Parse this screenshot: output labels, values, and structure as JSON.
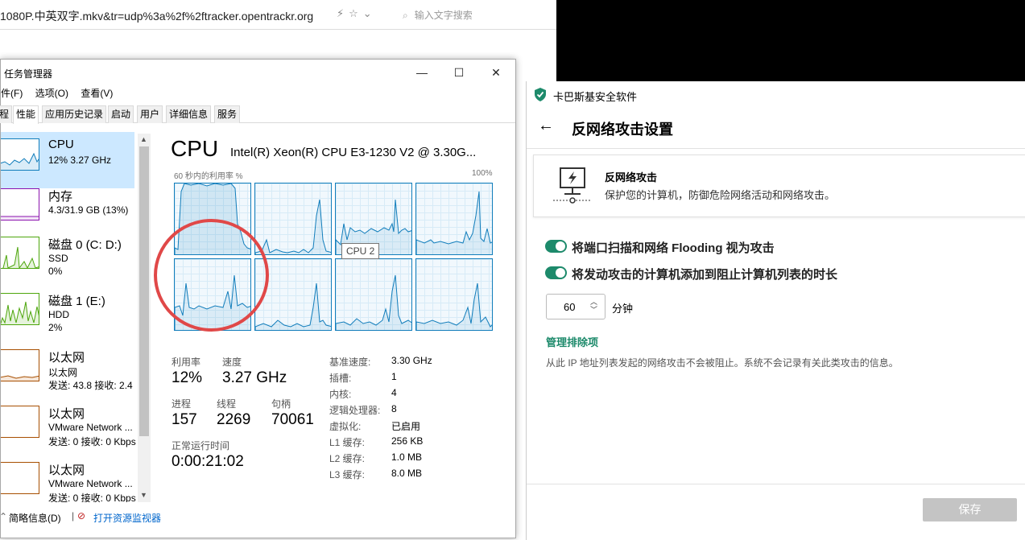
{
  "browser": {
    "url": "1080P.中英双字.mkv&tr=udp%3a%2f%2ftracker.opentrackr.org",
    "search_placeholder": "输入文字搜索"
  },
  "taskmgr": {
    "title": "任务管理器",
    "menus": [
      "件(F)",
      "选项(O)",
      "查看(V)"
    ],
    "tabs": [
      "程",
      "性能",
      "应用历史记录",
      "启动",
      "用户",
      "详细信息",
      "服务"
    ],
    "active_tab": "性能",
    "sidebar": [
      {
        "name": "CPU",
        "sub1": "12%  3.27 GHz",
        "sub2": "",
        "color": "#117dbb"
      },
      {
        "name": "内存",
        "sub1": "4.3/31.9 GB (13%)",
        "sub2": "",
        "color": "#8b12ae"
      },
      {
        "name": "磁盘 0 (C: D:)",
        "sub1": "SSD",
        "sub2": "0%",
        "color": "#4da60c"
      },
      {
        "name": "磁盘 1 (E:)",
        "sub1": "HDD",
        "sub2": "2%",
        "color": "#4da60c"
      },
      {
        "name": "以太网",
        "sub1": "以太网",
        "sub2": "发送: 43.8 接收: 2.4",
        "color": "#a74f01"
      },
      {
        "name": "以太网",
        "sub1": "VMware Network ...",
        "sub2": "发送: 0 接收: 0 Kbps",
        "color": "#a74f01"
      },
      {
        "name": "以太网",
        "sub1": "VMware Network ...",
        "sub2": "发送: 0 接收: 0 Kbps",
        "color": "#a74f01"
      }
    ],
    "cpu_header": "CPU",
    "cpu_model": "Intel(R) Xeon(R) CPU E3-1230 V2 @ 3.30G...",
    "graph_label": "60 秒内的利用率 %",
    "graph_max": "100%",
    "tooltip": "CPU 2",
    "stats": {
      "util_label": "利用率",
      "util_value": "12%",
      "speed_label": "速度",
      "speed_value": "3.27 GHz",
      "proc_label": "进程",
      "proc_value": "157",
      "thread_label": "线程",
      "thread_value": "2269",
      "handle_label": "句柄",
      "handle_value": "70061",
      "uptime_label": "正常运行时间",
      "uptime_value": "0:00:21:02"
    },
    "specs": [
      {
        "k": "基准速度:",
        "v": "3.30 GHz"
      },
      {
        "k": "插槽:",
        "v": "1"
      },
      {
        "k": "内核:",
        "v": "4"
      },
      {
        "k": "逻辑处理器:",
        "v": "8"
      },
      {
        "k": "虚拟化:",
        "v": "已启用"
      },
      {
        "k": "L1 缓存:",
        "v": "256 KB"
      },
      {
        "k": "L2 缓存:",
        "v": "1.0 MB"
      },
      {
        "k": "L3 缓存:",
        "v": "8.0 MB"
      }
    ],
    "footer_less": "简略信息(D)",
    "footer_link": "打开资源监视器"
  },
  "kaspersky": {
    "app_title": "卡巴斯基安全软件",
    "page_title": "反网络攻击设置",
    "card_title": "反网络攻击",
    "card_desc": "保护您的计算机，防御危险网络活动和网络攻击。",
    "toggle1": "将端口扫描和网络 Flooding 视为攻击",
    "toggle2": "将发动攻击的计算机添加到阻止计算机列表的时长",
    "duration": "60",
    "unit": "分钟",
    "manage_link": "管理排除项",
    "note": "从此 IP 地址列表发起的网络攻击不会被阻止。系统不会记录有关此类攻击的信息。",
    "save": "保存",
    "accent": "#1d8a6b"
  }
}
